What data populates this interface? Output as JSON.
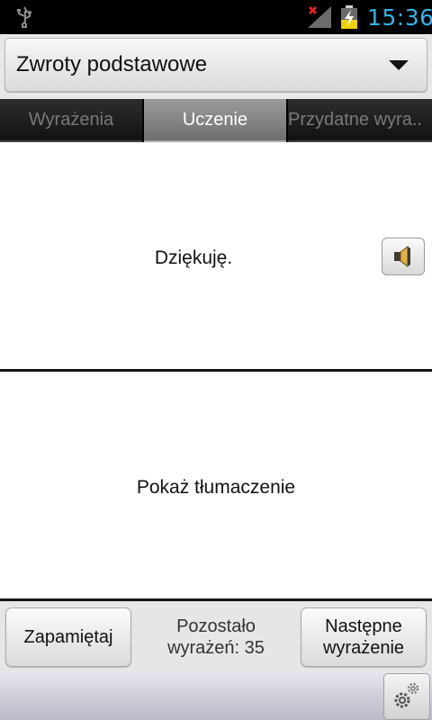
{
  "status_bar": {
    "time": "15:36",
    "icons": [
      "usb-icon",
      "no-signal-icon",
      "battery-charging-icon"
    ],
    "clock_color": "#33b5e5"
  },
  "spinner": {
    "selected": "Zwroty podstawowe"
  },
  "tabs": [
    {
      "label": "Wyrażenia",
      "active": false
    },
    {
      "label": "Uczenie",
      "active": true
    },
    {
      "label": "Przydatne wyra..",
      "active": false
    }
  ],
  "phrase": {
    "text": "Dziękuję.",
    "speaker_icon": "speaker-icon"
  },
  "translation": {
    "text": "Pokaż tłumaczenie"
  },
  "bottom": {
    "memorize_label": "Zapamiętaj",
    "remaining_line1": "Pozostało",
    "remaining_line2": "wyrażeń: 35",
    "next_line1": "Następne",
    "next_line2": "wyrażenie"
  },
  "settings": {
    "icon": "gears-icon"
  }
}
